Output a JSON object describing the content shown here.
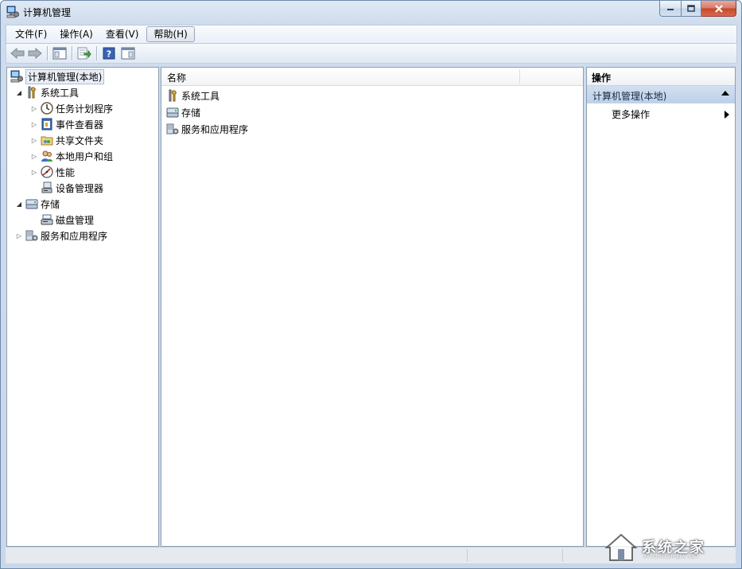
{
  "window": {
    "title": "计算机管理"
  },
  "menu": [
    {
      "label": "文件(F)"
    },
    {
      "label": "操作(A)"
    },
    {
      "label": "查看(V)"
    },
    {
      "label": "帮助(H)"
    }
  ],
  "tree": {
    "root": "计算机管理(本地)",
    "system_tools": "系统工具",
    "task_scheduler": "任务计划程序",
    "event_viewer": "事件查看器",
    "shared_folders": "共享文件夹",
    "local_users": "本地用户和组",
    "performance": "性能",
    "device_manager": "设备管理器",
    "storage": "存储",
    "disk_management": "磁盘管理",
    "services_apps": "服务和应用程序"
  },
  "list": {
    "column_name": "名称",
    "items": [
      "系统工具",
      "存储",
      "服务和应用程序"
    ]
  },
  "actions": {
    "header": "操作",
    "section": "计算机管理(本地)",
    "more": "更多操作"
  },
  "watermark": {
    "text": "系统之家",
    "sub": "XITONGZHIJIA.NET"
  },
  "colors": {
    "accent": "#bcd0e8",
    "close": "#c7452c"
  }
}
